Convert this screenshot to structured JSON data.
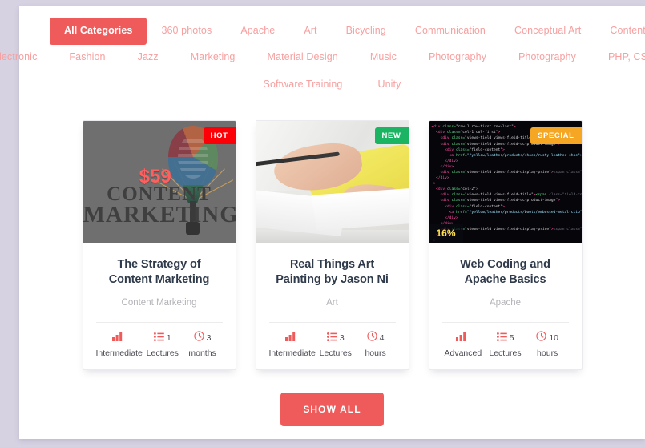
{
  "filters": {
    "rows": [
      [
        {
          "label": "All Categories",
          "active": true
        },
        {
          "label": "360 photos",
          "active": false
        },
        {
          "label": "Apache",
          "active": false
        },
        {
          "label": "Art",
          "active": false
        },
        {
          "label": "Bicycling",
          "active": false
        },
        {
          "label": "Communication",
          "active": false
        },
        {
          "label": "Conceptual Art",
          "active": false
        },
        {
          "label": "Content Marketing",
          "active": false
        }
      ],
      [
        {
          "label": "Electronic",
          "active": false
        },
        {
          "label": "Fashion",
          "active": false
        },
        {
          "label": "Jazz",
          "active": false
        },
        {
          "label": "Marketing",
          "active": false
        },
        {
          "label": "Material Design",
          "active": false
        },
        {
          "label": "Music",
          "active": false
        },
        {
          "label": "Photography",
          "active": false
        },
        {
          "label": "Photography",
          "active": false
        },
        {
          "label": "PHP, CSS, JS",
          "active": false
        }
      ],
      [
        {
          "label": "Software Training",
          "active": false
        },
        {
          "label": "Unity",
          "active": false
        }
      ]
    ]
  },
  "cards": [
    {
      "badge": {
        "text": "HOT",
        "color": "#fb0007"
      },
      "price": "$59",
      "discount": null,
      "title_line1": "The Strategy of",
      "title_line2": "Content Marketing",
      "category": "Content Marketing",
      "image_words": {
        "line1": "CONTENT",
        "line2": "MARKETING"
      },
      "meta": [
        {
          "icon": "bars-icon",
          "value": "",
          "label": "Intermediate"
        },
        {
          "icon": "list-icon",
          "value": "1",
          "label": "Lectures"
        },
        {
          "icon": "clock-icon",
          "value": "3",
          "label": "months"
        }
      ]
    },
    {
      "badge": {
        "text": "NEW",
        "color": "#1bb462"
      },
      "price": null,
      "discount": null,
      "title_line1": "Real Things Art",
      "title_line2": "Painting by Jason Ni",
      "category": "Art",
      "meta": [
        {
          "icon": "bars-icon",
          "value": "",
          "label": "Intermediate"
        },
        {
          "icon": "list-icon",
          "value": "3",
          "label": "Lectures"
        },
        {
          "icon": "clock-icon",
          "value": "4",
          "label": "hours"
        }
      ]
    },
    {
      "badge": {
        "text": "SPECIAL",
        "color": "#f5a623"
      },
      "price": null,
      "discount": "16%",
      "title_line1": "Web Coding and",
      "title_line2": "Apache Basics",
      "category": "Apache",
      "meta": [
        {
          "icon": "bars-icon",
          "value": "",
          "label": "Advanced"
        },
        {
          "icon": "list-icon",
          "value": "5",
          "label": "Lectures"
        },
        {
          "icon": "clock-icon",
          "value": "10",
          "label": "hours"
        }
      ]
    }
  ],
  "footer": {
    "show_all_label": "SHOW ALL"
  },
  "theme": {
    "accent": "#ef5a5a",
    "filter_text": "#f7a0a0",
    "title_text": "#2f3a4a",
    "category_text": "#b3b3b9",
    "page_background": "#d6d2e2",
    "panel_background": "#ffffff"
  }
}
